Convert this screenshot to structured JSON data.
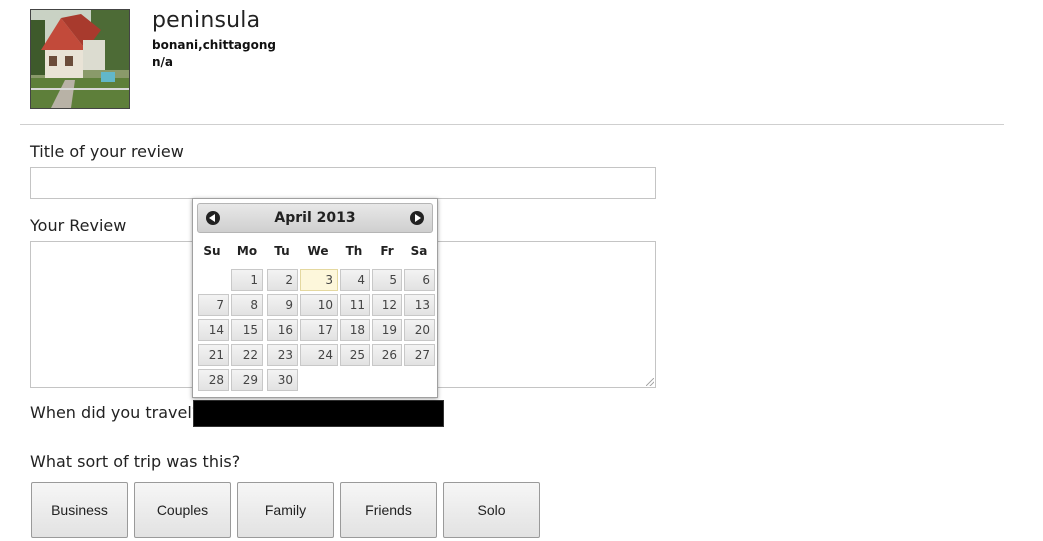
{
  "hotel": {
    "name": "peninsula",
    "location": "bonani,chittagong",
    "extra": "n/a"
  },
  "form": {
    "title_label": "Title of your review",
    "title_value": "",
    "review_label": "Your Review",
    "review_value": "",
    "travel_label": "When did you travel?",
    "travel_value": "",
    "trip_label": "What sort of trip was this?",
    "trip_options": [
      "Business",
      "Couples",
      "Family",
      "Friends",
      "Solo"
    ]
  },
  "datepicker": {
    "month_title": "April 2013",
    "weekdays": [
      "Su",
      "Mo",
      "Tu",
      "We",
      "Th",
      "Fr",
      "Sa"
    ],
    "days": [
      [
        "",
        "1",
        "2",
        "3",
        "4",
        "5",
        "6"
      ],
      [
        "7",
        "8",
        "9",
        "10",
        "11",
        "12",
        "13"
      ],
      [
        "14",
        "15",
        "16",
        "17",
        "18",
        "19",
        "20"
      ],
      [
        "21",
        "22",
        "23",
        "24",
        "25",
        "26",
        "27"
      ],
      [
        "28",
        "29",
        "30",
        "",
        "",
        "",
        ""
      ]
    ],
    "highlighted_day": "3"
  },
  "icons": {
    "prev": "circle-arrow-left-icon",
    "next": "circle-arrow-right-icon"
  }
}
